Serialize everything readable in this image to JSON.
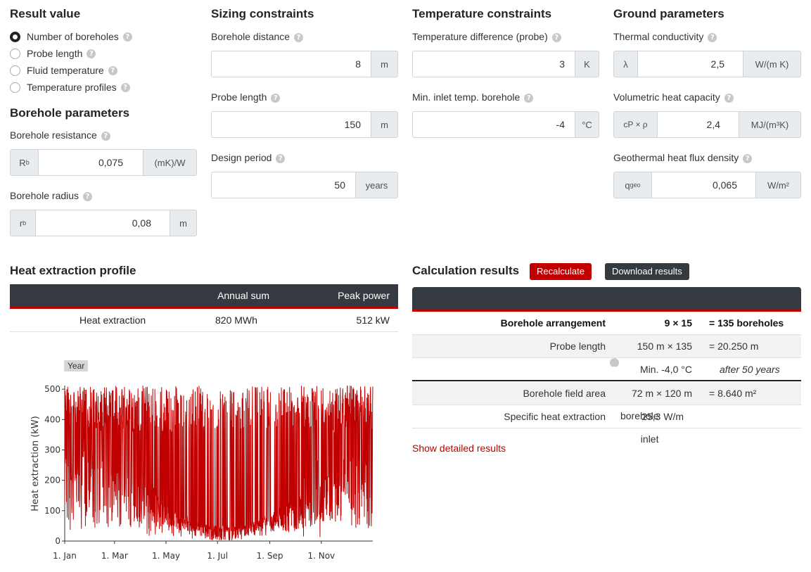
{
  "result_value": {
    "title": "Result value",
    "options": [
      {
        "label": "Number of boreholes",
        "checked": true
      },
      {
        "label": "Probe length",
        "checked": false
      },
      {
        "label": "Fluid temperature",
        "checked": false
      },
      {
        "label": "Temperature profiles",
        "checked": false
      }
    ]
  },
  "borehole_parameters": {
    "title": "Borehole parameters",
    "resistance": {
      "label": "Borehole resistance",
      "prefix": "R",
      "prefix_sub": "b",
      "value": "0,075",
      "unit": "(mK)/W"
    },
    "radius": {
      "label": "Borehole radius",
      "prefix": "r",
      "prefix_sub": "b",
      "value": "0,08",
      "unit": "m"
    }
  },
  "sizing": {
    "title": "Sizing constraints",
    "distance": {
      "label": "Borehole distance",
      "value": "8",
      "unit": "m"
    },
    "probe_length": {
      "label": "Probe length",
      "value": "150",
      "unit": "m"
    },
    "design_period": {
      "label": "Design period",
      "value": "50",
      "unit": "years"
    }
  },
  "temperature": {
    "title": "Temperature constraints",
    "difference": {
      "label": "Temperature difference (probe)",
      "value": "3",
      "unit": "K"
    },
    "min_inlet": {
      "label": "Min. inlet temp. borehole",
      "value": "-4",
      "unit": "°C"
    }
  },
  "ground": {
    "title": "Ground parameters",
    "conductivity": {
      "label": "Thermal conductivity",
      "prefix": "λ",
      "value": "2,5",
      "unit": "W/(m K)"
    },
    "heat_capacity": {
      "label": "Volumetric heat capacity",
      "prefix": "cP × ρ",
      "value": "2,4",
      "unit": "MJ/(m³K)"
    },
    "heat_flux": {
      "label": "Geothermal heat flux density",
      "prefix": "q",
      "prefix_sub": "geo",
      "value": "0,065",
      "unit": "W/m²"
    }
  },
  "heat_profile": {
    "title": "Heat extraction profile",
    "columns": [
      "",
      "Annual sum",
      "Peak power"
    ],
    "row": {
      "name": "Heat extraction",
      "annual_sum": "820 MWh",
      "peak": "512 kW"
    }
  },
  "results": {
    "title": "Calculation results",
    "recalculate": "Recalculate",
    "download": "Download results",
    "rows": [
      {
        "label": "Borehole arrangement",
        "value": "9 × 15",
        "extra": "= 135 boreholes"
      },
      {
        "label": "Probe length",
        "value": "150 m × 135",
        "extra": "= 20.250 m"
      },
      {
        "label": "Min. temperature borehole inlet",
        "value": "-4,0 °C",
        "extra": "after 50 years"
      },
      {
        "label": "Borehole field area",
        "value": "72 m × 120 m",
        "extra": "= 8.640 m²"
      },
      {
        "label": "Specific heat extraction",
        "value": "25,3 W/m",
        "extra": ""
      }
    ],
    "show_details": "Show detailed results"
  },
  "chart_data": {
    "type": "line",
    "legend_button": "Year",
    "ylabel": "Heat extraction (kW)",
    "xlabel": "",
    "ylim": [
      0,
      512
    ],
    "yticks": [
      0,
      100,
      200,
      300,
      400,
      500
    ],
    "x_ticks": [
      "1. Jan",
      "1. Mar",
      "1. May",
      "1. Jul",
      "1. Sep",
      "1. Nov"
    ],
    "x_range_hours": [
      0,
      8760
    ],
    "series": [
      {
        "color": "#c00000",
        "approx_peak": 512
      }
    ]
  }
}
